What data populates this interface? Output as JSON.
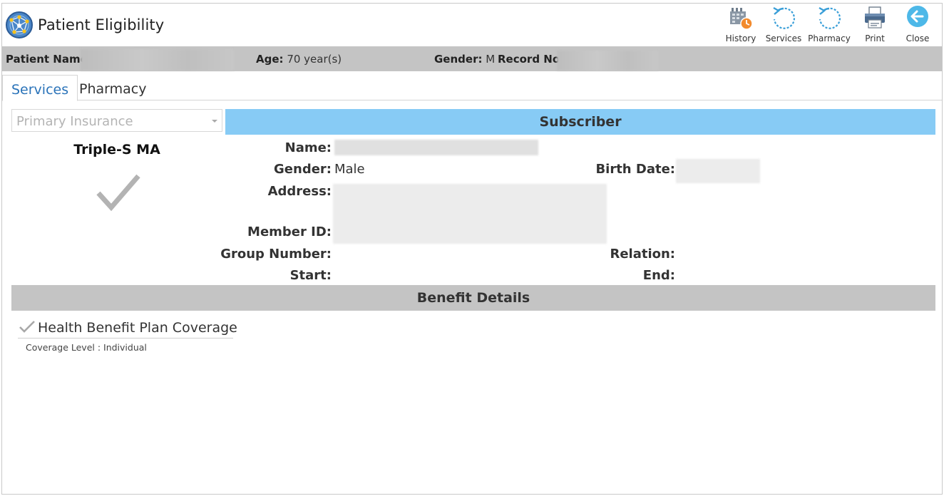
{
  "app": {
    "title": "Patient Eligibility"
  },
  "toolbar": {
    "history_label": "History",
    "services_label": "Services",
    "pharmacy_label": "Pharmacy",
    "print_label": "Print",
    "close_label": "Close"
  },
  "patient": {
    "name_label": "Patient Name:",
    "age_label": "Age:",
    "age_value": "70 year(s)",
    "gender_label": "Gender:",
    "gender_value": "M",
    "record_label": "Record No:"
  },
  "tabs": [
    {
      "label": "Services",
      "active": true
    },
    {
      "label": "Pharmacy",
      "active": false
    }
  ],
  "insurance": {
    "select_placeholder": "Primary Insurance",
    "plan_name": "Triple-S MA"
  },
  "subscriber": {
    "title": "Subscriber",
    "name_label": "Name:",
    "gender_label": "Gender:",
    "gender_value": "Male",
    "birth_date_label": "Birth Date:",
    "address_label": "Address:",
    "member_id_label": "Member ID:",
    "group_number_label": "Group Number:",
    "relation_label": "Relation:",
    "start_label": "Start:",
    "end_label": "End:"
  },
  "benefits": {
    "title": "Benefit Details",
    "items": [
      {
        "title": "Health Benefit Plan Coverage",
        "detail": "Coverage Level : Individual"
      }
    ]
  },
  "colors": {
    "subscriber_header": "#87cbf5",
    "gray_bar": "#c4c4c4",
    "active_tab": "#2a73b9",
    "close_button": "#4db8e8"
  },
  "icons": [
    "globe-network-icon",
    "calendar-clock-icon",
    "refresh-icon",
    "refresh-icon",
    "printer-icon",
    "back-arrow-icon",
    "checkmark-icon"
  ]
}
